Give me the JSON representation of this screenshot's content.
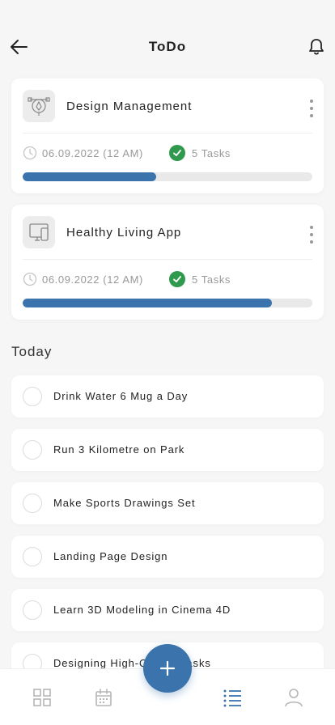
{
  "header": {
    "title": "ToDo",
    "back_icon": "arrow-left-icon",
    "notification_icon": "bell-icon"
  },
  "projects": [
    {
      "name": "Design Management",
      "icon": "pen-tool-icon",
      "date": "06.09.2022 (12 AM)",
      "tasks": "5 Tasks",
      "progress": 0.46
    },
    {
      "name": "Healthy Living App",
      "icon": "devices-icon",
      "date": "06.09.2022 (12 AM)",
      "tasks": "5 Tasks",
      "progress": 0.86
    }
  ],
  "today": {
    "title": "Today",
    "items": [
      "Drink Water 6 Mug a Day",
      "Run 3 Kilometre on Park",
      "Make Sports Drawings Set",
      "Landing Page Design",
      "Learn 3D Modeling in Cinema 4D",
      "Designing High-Quality Tasks"
    ]
  },
  "nav": {
    "items": [
      "grid-icon",
      "calendar-icon",
      "list-icon",
      "profile-icon"
    ],
    "active": "list-icon",
    "fab_icon": "plus-icon"
  },
  "colors": {
    "accent": "#3b74ad",
    "success": "#2f9a4e",
    "background": "#f6f6f6"
  }
}
